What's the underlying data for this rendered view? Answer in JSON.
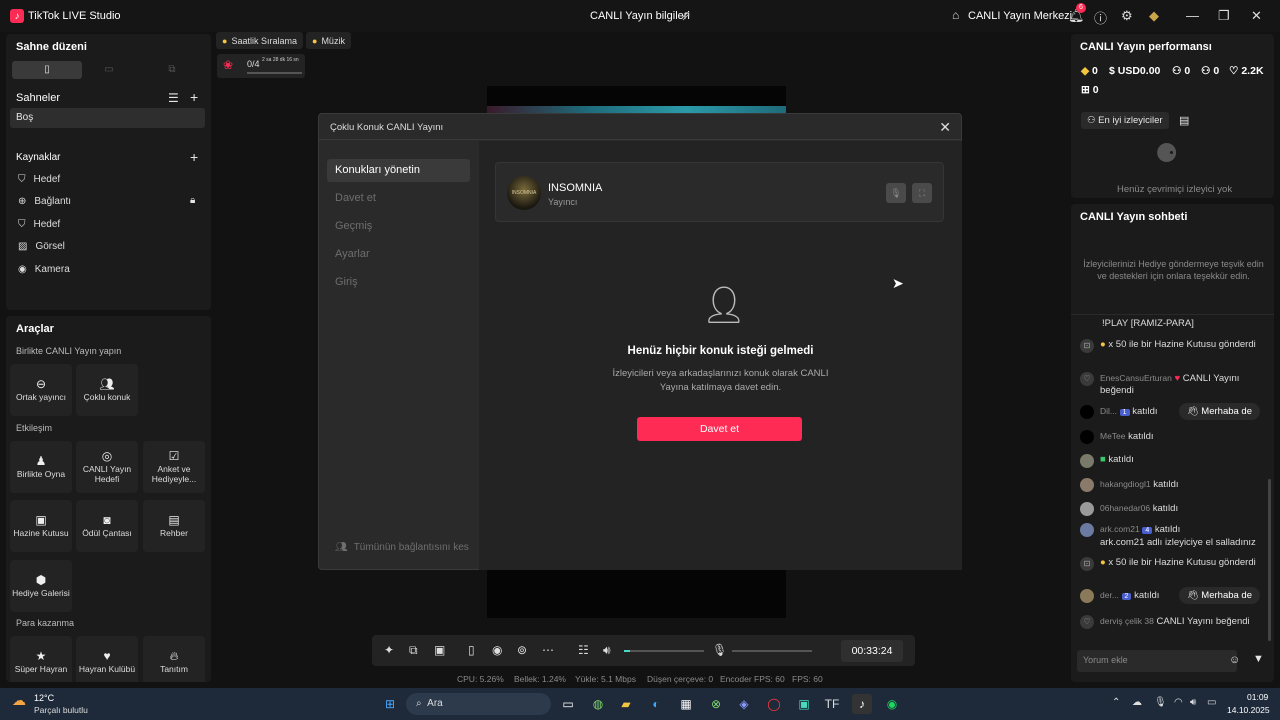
{
  "titlebar": {
    "app_title": "TikTok LIVE Studio",
    "center_title": "CANLI Yayın bilgileri",
    "home_label": "CANLI Yayın Merkezi",
    "notif_count": "6"
  },
  "left": {
    "scene_layout": "Sahne düzeni",
    "scenes_title": "Sahneler",
    "scene_item": "Boş",
    "sources_title": "Kaynaklar",
    "sources": [
      "Hedef",
      "Bağlantı",
      "Hedef",
      "Görsel",
      "Kamera"
    ],
    "tools_title": "Araçlar",
    "group1": "Birlikte CANLI Yayın yapın",
    "group1_items": [
      "Ortak yayıncı",
      "Çoklu konuk"
    ],
    "group2": "Etkileşim",
    "group2_items": [
      "Birlikte Oyna",
      "CANLI Yayın Hedefi",
      "Anket ve Hediyeyle...",
      "Hazine Kutusu",
      "Ödül Çantası",
      "Rehber",
      "Hediye Galerisi"
    ],
    "group3": "Para kazanma",
    "group3_items": [
      "Süper Hayran",
      "Hayran Kulübü",
      "Tanıtım"
    ]
  },
  "canvas": {
    "chip1": "Saatlik Sıralama",
    "chip2": "Müzik",
    "goal_progress": "0/4",
    "goal_timer": "2 sa 28 dk 16 sn"
  },
  "modal": {
    "title": "Çoklu Konuk CANLI Yayını",
    "nav": [
      "Konukları yönetin",
      "Davet et",
      "Geçmiş",
      "Ayarlar",
      "Giriş"
    ],
    "host_name": "INSOMNIA",
    "host_role": "Yayıncı",
    "avatar_text": "INSOMNIA",
    "empty_title": "Henüz hiçbir konuk isteği gelmedi",
    "empty_desc": "İzleyicileri veya arkadaşlarınızı konuk olarak CANLI Yayına katılmaya davet edin.",
    "invite_button": "Davet et",
    "disconnect_all": "Tümünün bağlantısını kes"
  },
  "right": {
    "perf_title": "CANLI Yayın performansı",
    "stats": [
      "0",
      "USD0.00",
      "0",
      "0",
      "2.2K",
      "0"
    ],
    "top_viewers": "En iyi izleyiciler",
    "no_viewers": "Henüz çevrimiçi izleyici yok",
    "chat_title": "CANLI Yayın sohbeti",
    "chat_hint": "İzleyicilerinizi Hediye göndermeye teşvik edin ve destekleri için onlara teşekkür edin.",
    "chat": [
      {
        "user": "",
        "text": "!PLAY [RAMIZ-PARA]"
      },
      {
        "user": "",
        "text": "x 50 ile bir Hazine Kutusu gönderdi"
      },
      {
        "user": "EnesCansuErturan",
        "text": "CANLI Yayını beğendi"
      },
      {
        "user": "Dil...",
        "level": "1",
        "text": "katıldı"
      },
      {
        "user": "MeTee",
        "text": "katıldı"
      },
      {
        "user": "",
        "text": "katıldı"
      },
      {
        "user": "hakangdiogl1",
        "text": "katıldı"
      },
      {
        "user": "06hanedar06",
        "text": "katıldı"
      },
      {
        "user": "ark.com21",
        "level": "4",
        "text": "katıldı",
        "extra": "ark.com21 adlı izleyiciye el salladınız"
      },
      {
        "user": "",
        "text": "x 50 ile bir Hazine Kutusu gönderdi"
      },
      {
        "user": "der...",
        "level": "2",
        "text": "katıldı"
      },
      {
        "user": "derviş çelik 38",
        "text": "CANLI Yayını beğendi"
      }
    ],
    "wave_label": "Merhaba de",
    "comment_placeholder": "Yorum ekle"
  },
  "controls": {
    "timer": "00:33:24"
  },
  "status": {
    "cpu": "CPU:  5.26%",
    "mem": "Bellek:  1.24%",
    "upload": "Yükle:  5.1 Mbps",
    "dropped": "Düşen çerçeve:  0",
    "enc_fps": "Encoder FPS:  60",
    "fps": "FPS:  60"
  },
  "taskbar": {
    "weather_temp": "12°C",
    "weather_desc": "Parçalı bulutlu",
    "search": "Ara",
    "time": "01:09",
    "date": "14.10.2025"
  }
}
